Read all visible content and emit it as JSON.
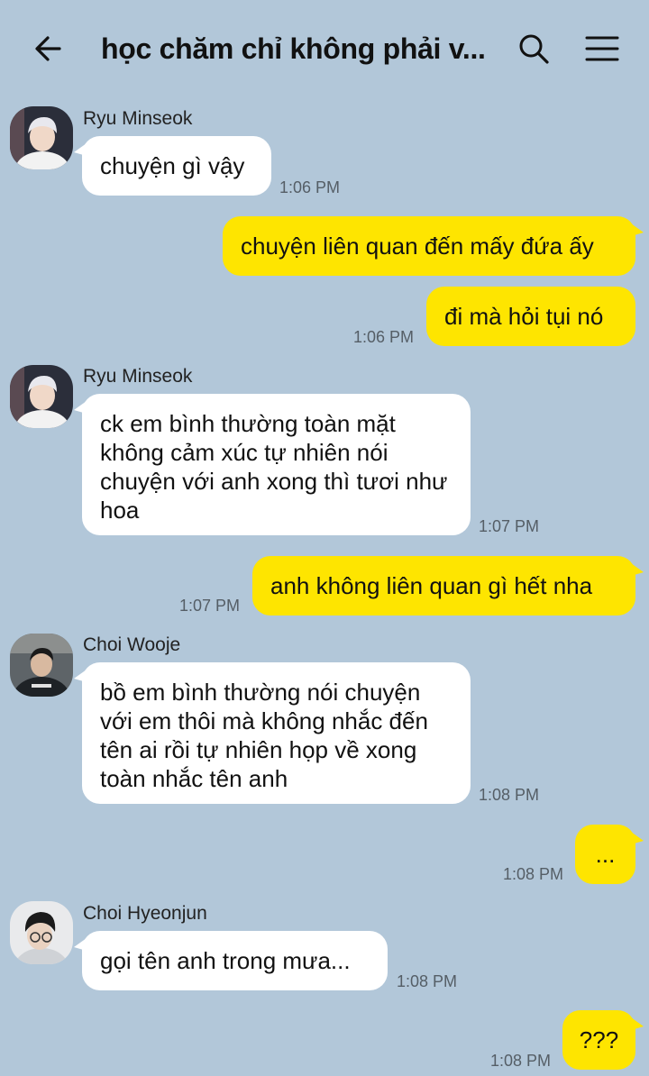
{
  "header": {
    "title": "học chăm chỉ không phải v..."
  },
  "colors": {
    "background": "#b2c7d9",
    "incoming_bubble": "#ffffff",
    "outgoing_bubble": "#fee500"
  },
  "messages": [
    {
      "sender": "Ryu Minseok",
      "text": "chuyện gì vậy",
      "time": "1:06 PM"
    },
    {
      "text": "chuyện liên quan đến mấy đứa ấy"
    },
    {
      "text": "đi mà hỏi tụi nó",
      "time": "1:06 PM"
    },
    {
      "sender": "Ryu Minseok",
      "text": "ck em bình thường toàn mặt không cảm xúc tự nhiên nói chuyện với anh xong thì tươi như hoa",
      "time": "1:07 PM"
    },
    {
      "text": "anh không liên quan gì hết nha",
      "time": "1:07 PM"
    },
    {
      "sender": "Choi Wooje",
      "text": "bồ em bình thường nói chuyện với em thôi mà không nhắc đến tên ai rồi tự nhiên họp về xong toàn nhắc tên anh",
      "time": "1:08 PM"
    },
    {
      "text": "...",
      "time": "1:08 PM"
    },
    {
      "sender": "Choi Hyeonjun",
      "text": "gọi tên anh trong mưa...",
      "time": "1:08 PM"
    },
    {
      "text": "???",
      "time": "1:08 PM"
    }
  ]
}
